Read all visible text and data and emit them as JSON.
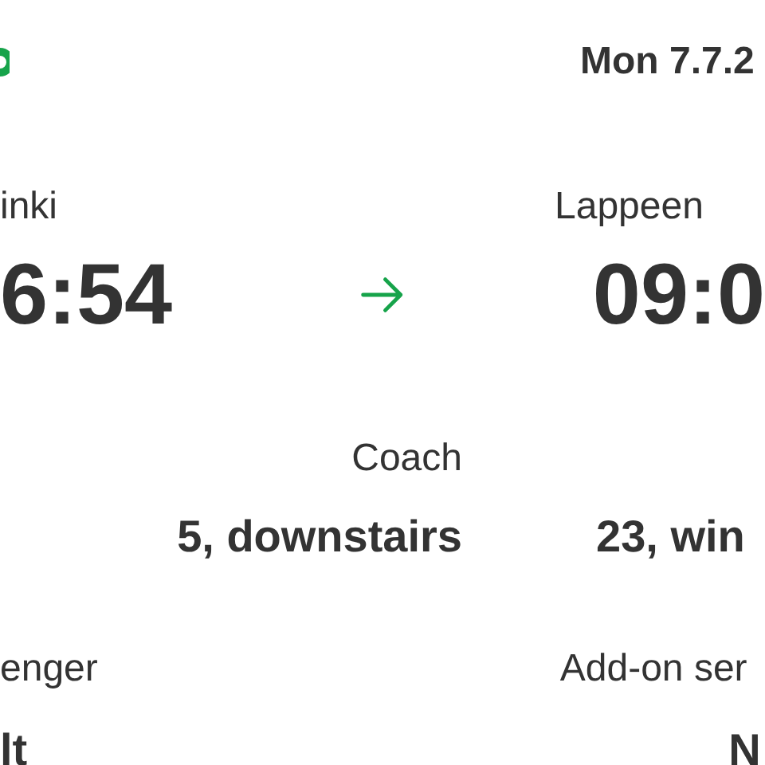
{
  "date": "Mon 7.7.2",
  "departure": {
    "station": "inki",
    "time": "6:54"
  },
  "arrival": {
    "station": "Lappeen",
    "time": "09:0"
  },
  "coach": {
    "label": "Coach",
    "value": "5, downstairs"
  },
  "seat": {
    "value": "23, win"
  },
  "passenger": {
    "label": "enger",
    "value": "lt"
  },
  "addons": {
    "label": "Add-on ser",
    "value": "N"
  }
}
